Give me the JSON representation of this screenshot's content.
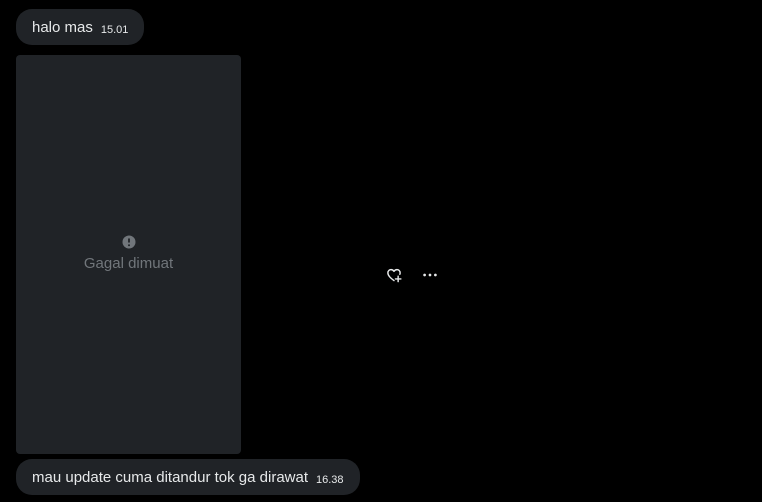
{
  "messages": [
    {
      "text": "halo mas",
      "time": "15.01"
    },
    {
      "text": "mau update cuma ditandur tok ga dirawat",
      "time": "16.38"
    }
  ],
  "media": {
    "error_icon": "error-circle-icon",
    "error_text": "Gagal dimuat"
  },
  "actions": {
    "react_icon": "heart-plus-icon",
    "more_icon": "more-horizontal-icon"
  },
  "colors": {
    "background": "#000000",
    "bubble": "#202327",
    "text": "#e7e9ea",
    "muted": "#71767b"
  }
}
